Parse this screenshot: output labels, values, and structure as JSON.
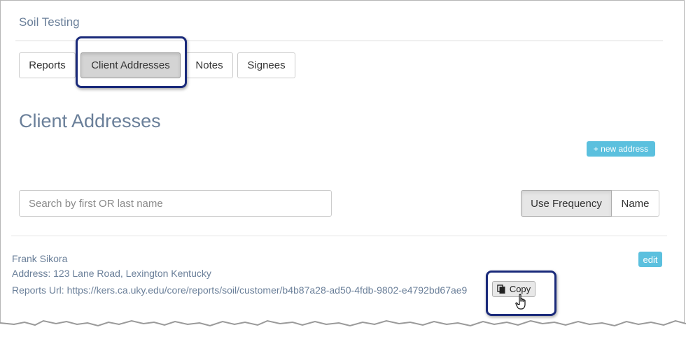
{
  "header": {
    "title": "Soil Testing"
  },
  "tabs": [
    {
      "label": "Reports"
    },
    {
      "label": "Client Addresses"
    },
    {
      "label": "Notes"
    },
    {
      "label": "Signees"
    }
  ],
  "section": {
    "title": "Client Addresses",
    "new_button": "+ new address"
  },
  "search": {
    "placeholder": "Search by first OR last name",
    "value": ""
  },
  "sort": {
    "options": [
      "Use Frequency",
      "Name"
    ],
    "selected": "Use Frequency"
  },
  "client": {
    "name": "Frank Sikora",
    "address": "Address: 123 Lane Road, Lexington Kentucky",
    "reports_url": "Reports Url: https://kers.ca.uky.edu/core/reports/soil/customer/b4b87a28-ad50-4fdb-9802-e4792bd67ae9",
    "edit_label": "edit",
    "copy_label": "Copy"
  },
  "colors": {
    "accent": "#5bc0de",
    "heading": "#6a7f99",
    "highlight_border": "#1a2a7a"
  },
  "icons": [
    "copy-icon",
    "hand-pointer-icon"
  ]
}
